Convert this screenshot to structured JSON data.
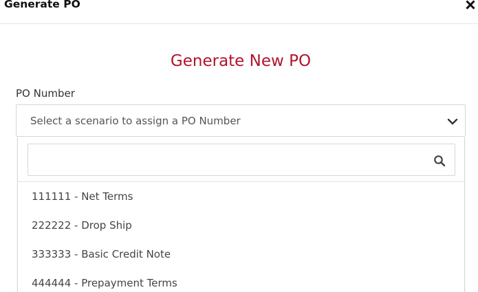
{
  "modal": {
    "title": "Generate PO",
    "close_icon": "close-icon"
  },
  "form": {
    "heading": "Generate New PO",
    "po_number_label": "PO Number",
    "select_placeholder": "Select a scenario to assign a PO Number",
    "chevron_icon": "chevron-down-icon"
  },
  "dropdown": {
    "search_value": "",
    "search_icon": "search-icon",
    "options": [
      {
        "label": "111111 - Net Terms"
      },
      {
        "label": "222222 - Drop Ship"
      },
      {
        "label": "333333 - Basic Credit Note"
      },
      {
        "label": "444444 - Prepayment Terms"
      }
    ]
  },
  "colors": {
    "heading": "#b0142d",
    "text": "#333333",
    "border": "#d6d6d6"
  }
}
